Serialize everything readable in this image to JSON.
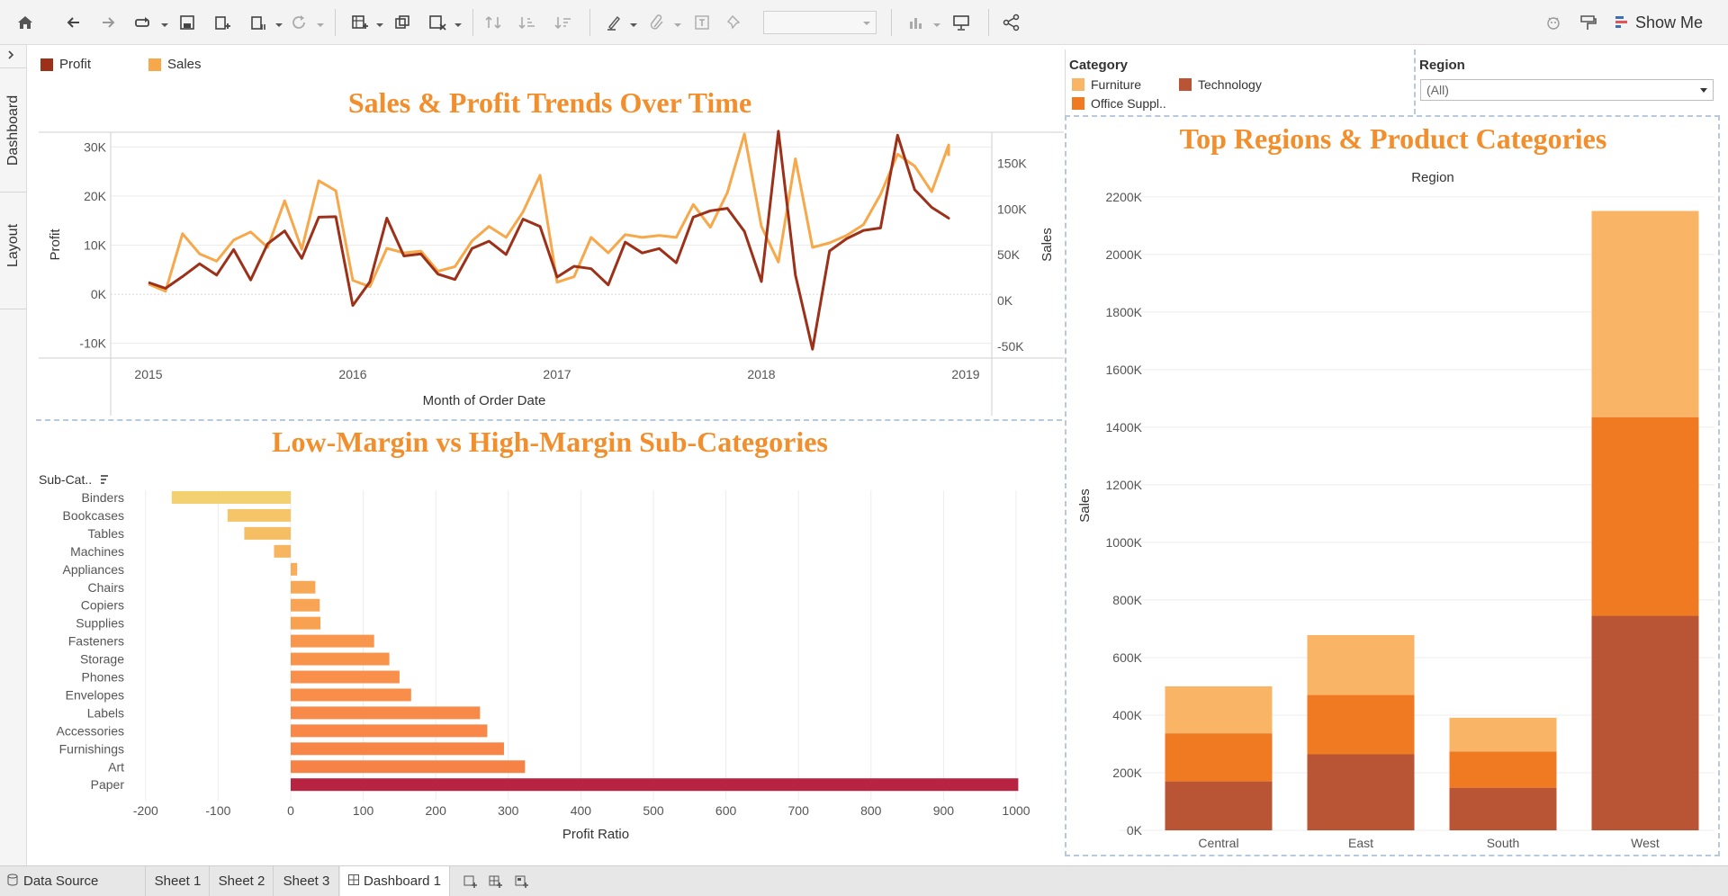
{
  "toolbar": {
    "show_me_label": "Show Me",
    "icons": [
      "home-icon",
      "undo-icon",
      "redo-icon",
      "replay-icon",
      "save-icon",
      "add-datasource-icon",
      "pause-icon",
      "refresh-icon",
      "new-worksheet-icon",
      "duplicate-icon",
      "clear-icon",
      "swap-icon",
      "sort-asc-icon",
      "sort-desc-icon",
      "highlight-icon",
      "group-icon",
      "label-icon",
      "pin-icon",
      "fit-combo",
      "chart-icon",
      "presentation-icon",
      "share-icon",
      "tableau-icon",
      "format-icon"
    ]
  },
  "side_tabs": {
    "dashboard_label": "Dashboard",
    "layout_label": "Layout"
  },
  "legend_top": {
    "items": [
      {
        "label": "Profit",
        "color": "#9c3018"
      },
      {
        "label": "Sales",
        "color": "#f7a84a"
      }
    ]
  },
  "filters": {
    "category_title": "Category",
    "category_items": [
      {
        "label": "Furniture",
        "color": "#f9b466"
      },
      {
        "label": "Technology",
        "color": "#b95535"
      },
      {
        "label": "Office Suppl..",
        "color": "#ef7a22"
      }
    ],
    "region_title": "Region",
    "region_value": "(All)"
  },
  "colors": {
    "title_orange": "#f28e2b",
    "profit_line": "#9c3018",
    "sales_line": "#f7a84a",
    "paper_bar": "#b92342"
  },
  "line_chart": {
    "title": "Sales & Profit Trends Over Time",
    "chart_data": {
      "type": "line",
      "xlabel": "Month of Order Date",
      "x_ticks": [
        "2015",
        "2016",
        "2017",
        "2018",
        "2019"
      ],
      "y_left_label": "Profit",
      "y_left_ticks": [
        "30K",
        "20K",
        "10K",
        "0K",
        "-10K"
      ],
      "y_left_lim": [
        -13000,
        33000
      ],
      "y_right_label": "Sales",
      "y_right_ticks": [
        "150K",
        "100K",
        "50K",
        "0K",
        "-50K"
      ],
      "y_right_lim": [
        -63000,
        184000
      ],
      "months": [
        "2015-01",
        "2015-02",
        "2015-03",
        "2015-04",
        "2015-05",
        "2015-06",
        "2015-07",
        "2015-08",
        "2015-09",
        "2015-10",
        "2015-11",
        "2015-12",
        "2016-01",
        "2016-02",
        "2016-03",
        "2016-04",
        "2016-05",
        "2016-06",
        "2016-07",
        "2016-08",
        "2016-09",
        "2016-10",
        "2016-11",
        "2016-12",
        "2017-01",
        "2017-02",
        "2017-03",
        "2017-04",
        "2017-05",
        "2017-06",
        "2017-07",
        "2017-08",
        "2017-09",
        "2017-10",
        "2017-11",
        "2017-12",
        "2018-01",
        "2018-02",
        "2018-03",
        "2018-04",
        "2018-05",
        "2018-06",
        "2018-07",
        "2018-08",
        "2018-09",
        "2018-10",
        "2018-11",
        "2018-12"
      ],
      "series": [
        {
          "name": "Profit",
          "axis": "left",
          "values": [
            2400,
            1200,
            3600,
            6200,
            3900,
            9100,
            2900,
            10300,
            12900,
            7300,
            15700,
            15800,
            -2300,
            2500,
            15500,
            7800,
            8200,
            4100,
            3000,
            9300,
            10800,
            8100,
            15300,
            13800,
            3500,
            5700,
            5200,
            1900,
            10600,
            8400,
            9300,
            6400,
            15700,
            17000,
            17500,
            12800,
            2600,
            33200,
            3900,
            -11200,
            8800,
            11300,
            13000,
            13500,
            32400,
            21300,
            17700,
            15500,
            15600
          ]
        },
        {
          "name": "Sales",
          "axis": "right",
          "values": [
            18000,
            10000,
            73000,
            51000,
            43000,
            66000,
            75000,
            58000,
            109000,
            56000,
            131000,
            120000,
            22000,
            15000,
            57000,
            52000,
            54000,
            32000,
            37000,
            65000,
            81000,
            69000,
            97000,
            137000,
            20000,
            26000,
            69000,
            52000,
            72000,
            69000,
            71000,
            69000,
            105000,
            80000,
            118000,
            182000,
            81000,
            42000,
            155000,
            58000,
            63000,
            71000,
            83000,
            116000,
            160000,
            147000,
            119000,
            170000,
            158000
          ]
        }
      ]
    }
  },
  "bar_chart": {
    "title": "Low-Margin vs High-Margin Sub-Categories",
    "chart_data": {
      "type": "bar",
      "orientation": "horizontal",
      "header_label": "Sub-Cat..",
      "xlabel": "Profit Ratio",
      "x_ticks": [
        "-200",
        "-100",
        "0",
        "100",
        "200",
        "300",
        "400",
        "500",
        "600",
        "700",
        "800",
        "900",
        "1000"
      ],
      "xlim": [
        -200,
        1000
      ],
      "categories": [
        "Binders",
        "Bookcases",
        "Tables",
        "Machines",
        "Appliances",
        "Chairs",
        "Copiers",
        "Supplies",
        "Fasteners",
        "Storage",
        "Phones",
        "Envelopes",
        "Labels",
        "Accessories",
        "Furnishings",
        "Art",
        "Paper"
      ],
      "values": [
        -164,
        -87,
        -64,
        -23,
        9,
        34,
        40,
        41,
        115,
        136,
        150,
        166,
        261,
        271,
        294,
        323,
        1003
      ],
      "colors": [
        "#f3d170",
        "#f5c568",
        "#f5be63",
        "#f6b560",
        "#f7ad5c",
        "#f7a857",
        "#f8a454",
        "#f8a151",
        "#f8964d",
        "#f8934c",
        "#f8904b",
        "#f88e4a",
        "#f88a49",
        "#f88748",
        "#f78547",
        "#f78246",
        "#b92342"
      ]
    }
  },
  "stacked_chart": {
    "title": "Top Regions & Product Categories",
    "chart_data": {
      "type": "bar",
      "stacked": true,
      "header_label": "Region",
      "ylabel": "Sales",
      "y_ticks": [
        "2200K",
        "2000K",
        "1800K",
        "1600K",
        "1400K",
        "1200K",
        "1000K",
        "800K",
        "600K",
        "400K",
        "200K",
        "0K"
      ],
      "ylim": [
        0,
        2290000
      ],
      "categories": [
        "Central",
        "East",
        "South",
        "West"
      ],
      "series": [
        {
          "name": "Technology",
          "color": "#b95535",
          "values": [
            170000,
            264000,
            148000,
            745000
          ]
        },
        {
          "name": "Office Supplies",
          "color": "#ef7a22",
          "values": [
            167000,
            206000,
            126000,
            690000
          ]
        },
        {
          "name": "Furniture",
          "color": "#f9b466",
          "values": [
            163000,
            208000,
            117000,
            716000
          ]
        }
      ]
    }
  },
  "status_bar": {
    "data_source": "Data Source",
    "sheets": [
      "Sheet 1",
      "Sheet 2",
      "Sheet 3"
    ],
    "active": "Dashboard 1"
  }
}
